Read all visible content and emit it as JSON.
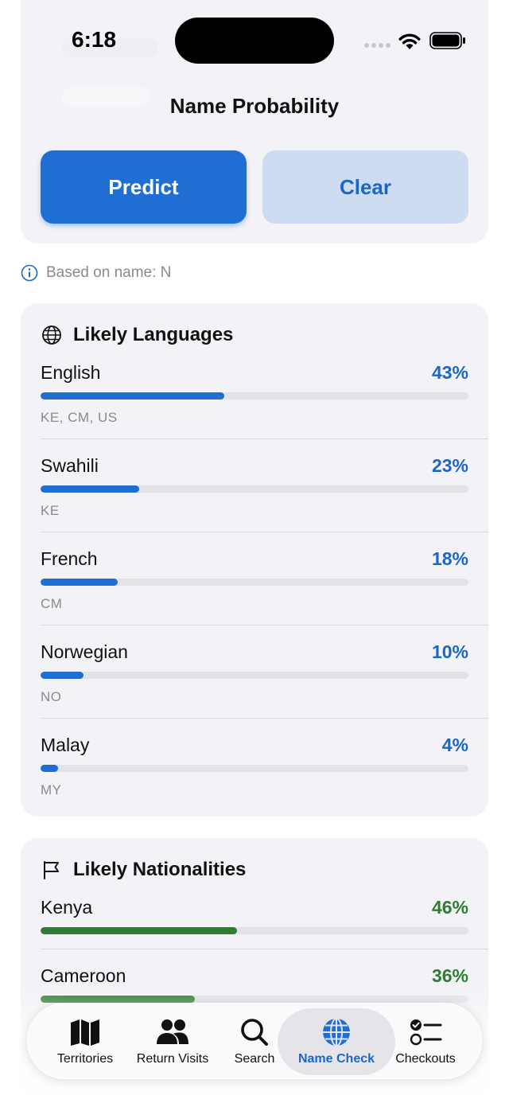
{
  "status_bar": {
    "time": "6:18"
  },
  "header": {
    "title": "Name Probability"
  },
  "actions": {
    "predict_label": "Predict",
    "clear_label": "Clear"
  },
  "info": {
    "text": "Based on name: N",
    "icon": "info-circle-icon"
  },
  "languages": {
    "title": "Likely Languages",
    "icon": "globe-icon",
    "items": [
      {
        "name": "English",
        "percent": "43%",
        "value": 43,
        "codes": "KE, CM, US"
      },
      {
        "name": "Swahili",
        "percent": "23%",
        "value": 23,
        "codes": "KE"
      },
      {
        "name": "French",
        "percent": "18%",
        "value": 18,
        "codes": "CM"
      },
      {
        "name": "Norwegian",
        "percent": "10%",
        "value": 10,
        "codes": "NO"
      },
      {
        "name": "Malay",
        "percent": "4%",
        "value": 4,
        "codes": "MY"
      }
    ]
  },
  "nationalities": {
    "title": "Likely Nationalities",
    "icon": "flag-icon",
    "items": [
      {
        "name": "Kenya",
        "percent": "46%",
        "value": 46
      },
      {
        "name": "Cameroon",
        "percent": "36%",
        "value": 36
      }
    ]
  },
  "tabbar": {
    "tabs": [
      {
        "label": "Territories",
        "icon": "map-icon"
      },
      {
        "label": "Return Visits",
        "icon": "people-icon"
      },
      {
        "label": "Search",
        "icon": "search-icon"
      },
      {
        "label": "Name Check",
        "icon": "globe-icon",
        "active": true
      },
      {
        "label": "Checkouts",
        "icon": "checklist-icon"
      }
    ]
  },
  "colors": {
    "accent_blue": "#1f6ed4",
    "accent_green": "#2e7d32",
    "card_bg": "#f2f2f7"
  }
}
